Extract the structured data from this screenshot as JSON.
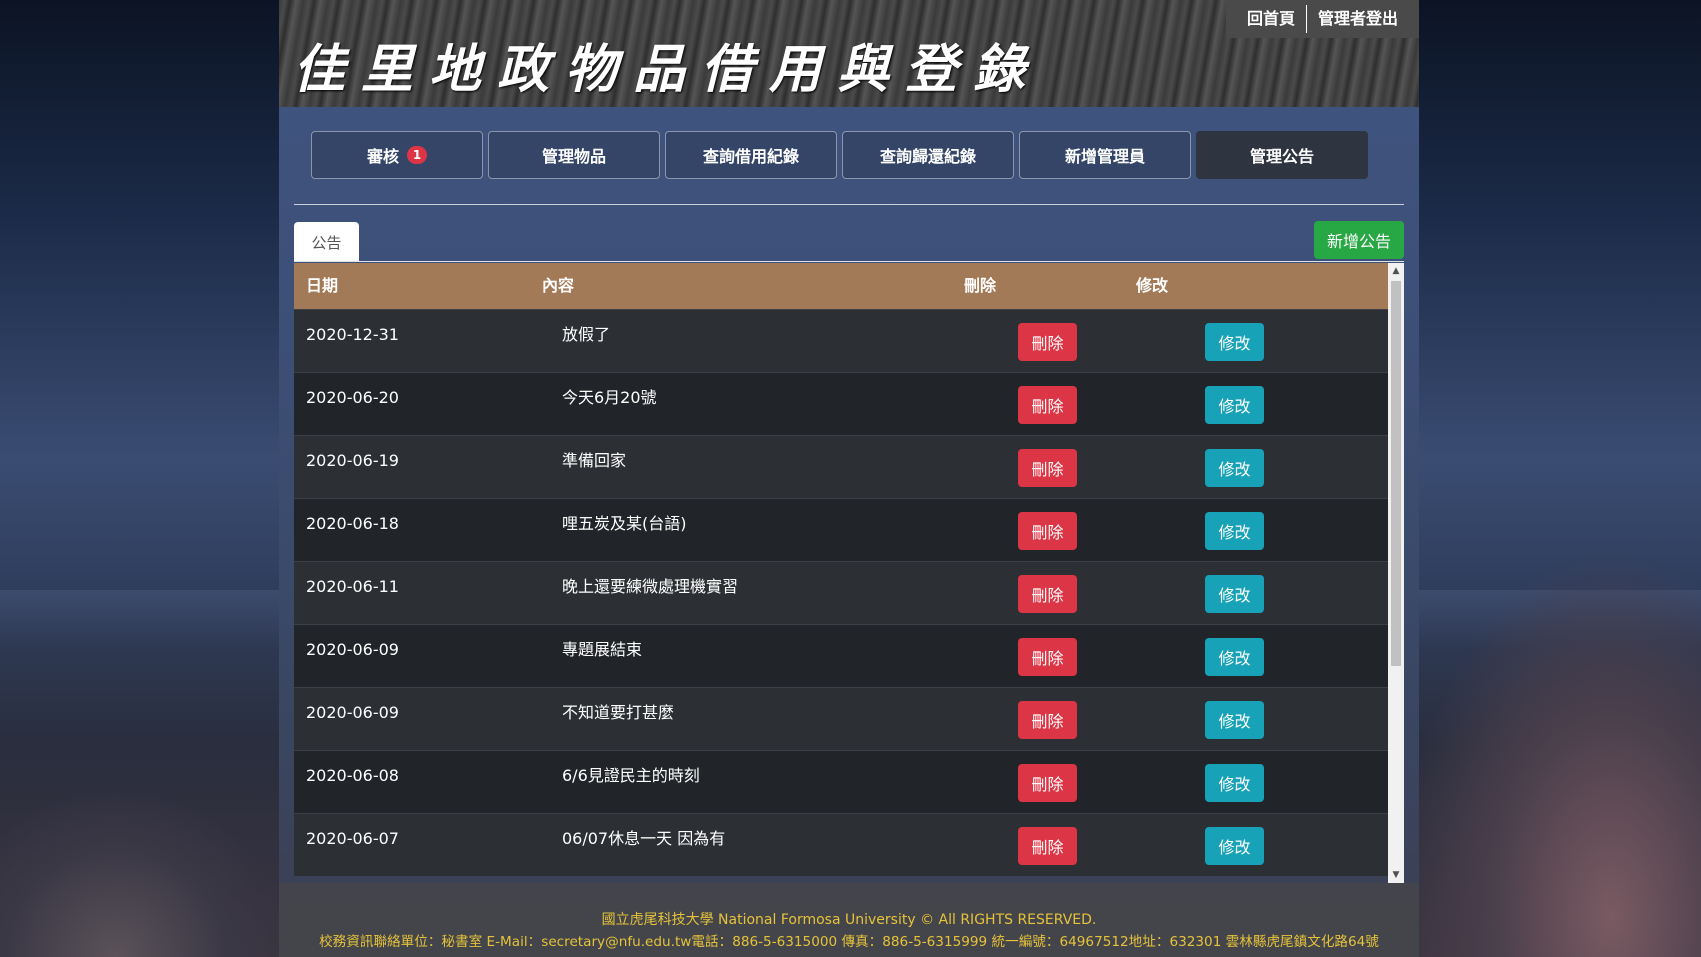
{
  "header": {
    "title": "佳里地政物品借用與登錄",
    "links": [
      "回首頁",
      "管理者登出"
    ]
  },
  "nav": {
    "items": [
      {
        "label": "審核",
        "badge": "1"
      },
      {
        "label": "管理物品"
      },
      {
        "label": "查詢借用紀錄"
      },
      {
        "label": "查詢歸還紀錄"
      },
      {
        "label": "新增管理員"
      },
      {
        "label": "管理公告"
      }
    ],
    "active": "管理公告"
  },
  "tab": {
    "label": "公告"
  },
  "add_button": "新增公告",
  "table": {
    "headers": [
      "日期",
      "內容",
      "刪除",
      "修改"
    ],
    "delete_label": "刪除",
    "edit_label": "修改",
    "rows": [
      {
        "date": "2020-12-31",
        "content": "放假了"
      },
      {
        "date": "2020-06-20",
        "content": "今天6月20號"
      },
      {
        "date": "2020-06-19",
        "content": "準備回家"
      },
      {
        "date": "2020-06-18",
        "content": "哩五炭及某(台語)"
      },
      {
        "date": "2020-06-11",
        "content": "晚上還要練微處理機實習"
      },
      {
        "date": "2020-06-09",
        "content": "專題展結束"
      },
      {
        "date": "2020-06-09",
        "content": "不知道要打甚麼"
      },
      {
        "date": "2020-06-08",
        "content": "6/6見證民主的時刻"
      },
      {
        "date": "2020-06-07",
        "content": "06/07休息一天 因為有"
      }
    ]
  },
  "footer": {
    "line1": "國立虎尾科技大學 National Formosa University © All RIGHTS RESERVED.",
    "line2": "校務資訊聯絡單位：秘書室 E-Mail：secretary@nfu.edu.tw電話：886-5-6315000 傳真：886-5-6315999 統一編號：64967512地址：632301 雲林縣虎尾鎮文化路64號"
  },
  "colors": {
    "table_header": "#a37a58",
    "delete": "#dc3545",
    "edit": "#17a2b8",
    "add": "#28a745",
    "footer_text": "#e5c23a"
  }
}
